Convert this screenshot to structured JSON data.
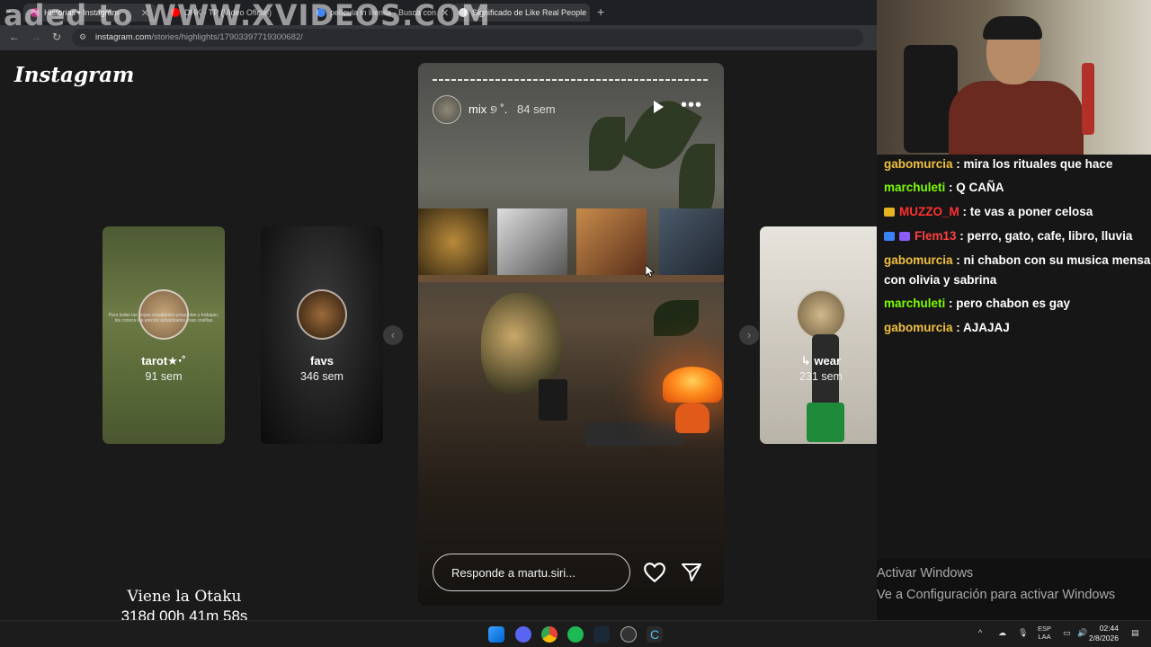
{
  "browser": {
    "tabs": [
      {
        "label": "Historias • Instagram",
        "active": true,
        "color": "#c13584"
      },
      {
        "label": "DHK - TP (Video Oficial)",
        "active": false,
        "color": "#ff0000"
      },
      {
        "label": "película in lilenila - Busca con",
        "active": false,
        "color": "#4285f4"
      },
      {
        "label": "Significado de Like Real People",
        "active": true,
        "color": "#dddddd"
      }
    ],
    "url_host": "instagram.com",
    "url_path": "/stories/highlights/17903397719300682/"
  },
  "watermark": "aded to WWW.XVIDEOS.COM",
  "instagram": {
    "logo": "Instagram",
    "side_stories": [
      {
        "name": "tarot★‧˚",
        "time": "91 sem",
        "tiny_text": "Para todas las brujas estudiantes preguntan y trabajan, los conoce los precios actualizados esas cosiñas"
      },
      {
        "name": "favs",
        "time": "346 sem"
      },
      {
        "name": "↳ wear",
        "time": "231 sem"
      }
    ],
    "main_story": {
      "user": "mix ୭ ˚.",
      "time": "84 sem",
      "reply_placeholder": "Responde a martu.siri..."
    },
    "icons": {
      "prev": "chevron-left-icon",
      "next": "chevron-right-icon",
      "play": "play-icon",
      "more": "more-icon",
      "like": "heart-icon",
      "share": "send-icon"
    }
  },
  "chat": [
    {
      "user": "gabomurcia",
      "color": "#f0c040",
      "message": "mira los rituales que hace"
    },
    {
      "user": "marchuleti",
      "color": "#7cfc00",
      "message": "Q CAÑA"
    },
    {
      "user": "MUZZO_M",
      "color": "#ff3030",
      "message": "te vas a poner celosa",
      "badge": "#e6b422"
    },
    {
      "user": "Flem13",
      "color": "#ff4040",
      "message": "perro, gato, cafe, libro, lluvia",
      "badge": "#3b82f6"
    },
    {
      "user": "gabomurcia",
      "color": "#f0c040",
      "message": "ni chabon con su musica mensa con olivia y sabrina"
    },
    {
      "user": "marchuleti",
      "color": "#7cfc00",
      "message": "pero chabon es gay"
    },
    {
      "user": "gabomurcia",
      "color": "#f0c040",
      "message": "AJAJAJ"
    }
  ],
  "windows_activation": {
    "line1": "Activar Windows",
    "line2": "Ve a Configuración para activar Windows"
  },
  "overlay": {
    "title": "Viene la Otaku",
    "countdown": "318d 00h 41m 58s"
  },
  "taskbar": {
    "lang": "ESP",
    "lang_sub": "LAA",
    "time": "02:44",
    "date": "2/8/2026"
  }
}
